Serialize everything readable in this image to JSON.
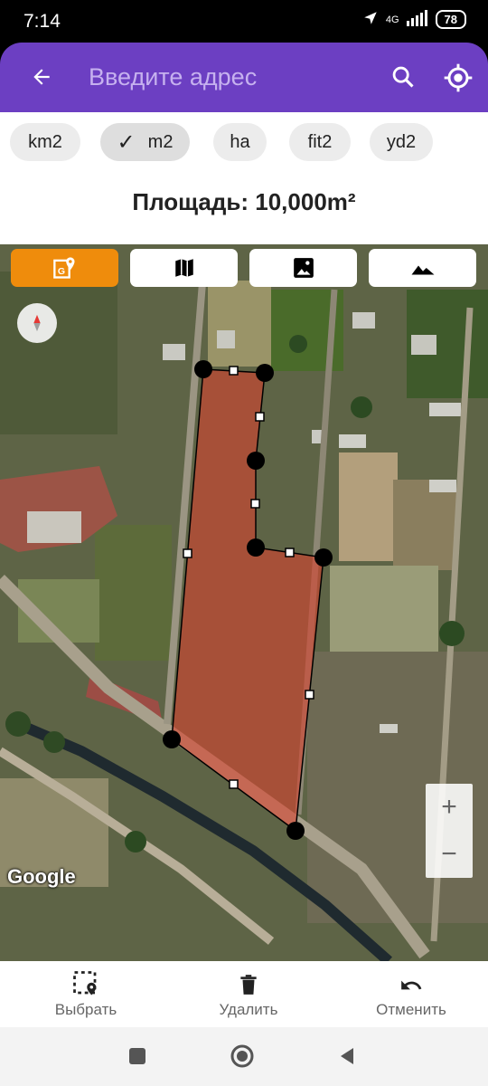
{
  "status": {
    "time": "7:14",
    "network": "4G",
    "battery": "78"
  },
  "appbar": {
    "search_placeholder": "Введите адрес"
  },
  "units": [
    {
      "label": "km2",
      "selected": false
    },
    {
      "label": "m2",
      "selected": true
    },
    {
      "label": "ha",
      "selected": false
    },
    {
      "label": "fit2",
      "selected": false
    },
    {
      "label": "yd2",
      "selected": false
    }
  ],
  "area_text": "Площадь: 10,000m²",
  "map": {
    "layer_buttons": [
      "hybrid-layer",
      "map-layer",
      "satellite-layer",
      "terrain-layer"
    ],
    "active_layer": "hybrid-layer",
    "google_attribution": "Google",
    "zoom_in": "+",
    "zoom_out": "−",
    "polygon_fill": "#d9432f",
    "accent": "#ef8c0c"
  },
  "actions": {
    "select": "Выбрать",
    "delete": "Удалить",
    "undo": "Отменить"
  },
  "colors": {
    "appbar": "#6c3fc2"
  }
}
